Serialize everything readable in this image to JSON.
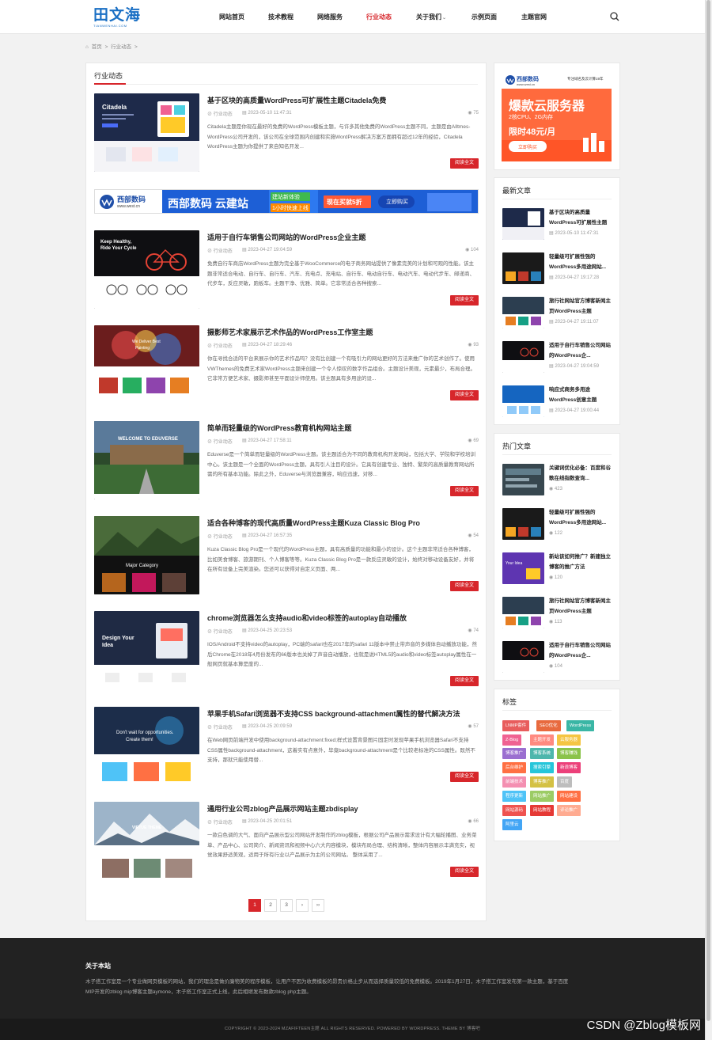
{
  "header": {
    "logo_main": "田文海",
    "logo_sub": "TIANWENHAI.COM",
    "nav": [
      {
        "label": "网站首页"
      },
      {
        "label": "技术教程"
      },
      {
        "label": "网络服务"
      },
      {
        "label": "行业动态"
      },
      {
        "label": "关于我们"
      },
      {
        "label": "示例页面"
      },
      {
        "label": "主题官网"
      }
    ],
    "search_icon": "search-icon"
  },
  "breadcrumb": {
    "home": "首页",
    "sep": ">",
    "current": "行业动态"
  },
  "main": {
    "section_title": "行业动态",
    "read_more_label": "阅读全文",
    "articles": [
      {
        "title": "基于区块的高质量WordPress可扩展性主题Citadela免费",
        "category": "行业动态",
        "date": "2023-05-10 11:47:31",
        "views": "75",
        "excerpt": "Citadela主题是你现在最好的免费的WordPress模板主题，与许多其他免费的WordPress主题不同，主题是由Alltmes-WordPress公司开发的，该公司在全球范围内创建和实施WordPress解决方案方面拥有超过12年的经验，Citadela WordPress主题为你提供了来自知名开发..."
      },
      {
        "title": "适用于自行车销售公司网站的WordPress企业主题",
        "category": "行业动态",
        "date": "2023-04-27 19:04:59",
        "views": "104",
        "excerpt": "免费自行车商店WordPress主题为完全基于WooCommerce的电子商务网站提供了像素完美的计划和可观的性能。该主题非常适合电动、自行车、自行车、汽车、充电点、充电站、自行车、电动自行车、电动汽车、电动代步车、邮递商、代步车，反应灵敏，跑板车。主题干净、优雅、简单。它非常适合各种搜索..."
      },
      {
        "title": "摄影师艺术家展示艺术作品的WordPress工作室主题",
        "category": "行业动态",
        "date": "2023-04-27 18:29:46",
        "views": "93",
        "excerpt": "你在寻找合适的平台来展示你的艺术作品吗？没有比创建一个有吸引力的网站更好的方法来推广你的艺术创作了。使用VWThemes的免费艺术家WordPress主题来创建一个令人惊叹的数字作品组合。主题设计美观，元素最少，布局合理。它非常方便艺术家、摄影师甚至平面设计师使用。该主题具有多用途的设..."
      },
      {
        "title": "简单而轻量级的WordPress教育机构网站主题",
        "category": "行业动态",
        "date": "2023-04-27 17:58:11",
        "views": "69",
        "excerpt": "Eduverse是一个简单而轻量级的WordPress主题。该主题适合为不同的教育机构开发网站，包括大学、学院和学校培训中心。该主题是一个全面的WordPress主题，具有引人注目的设计。它具有创建专业、独特、繁荣的高质量教育网站所需的所有基本功能。除此之外，Eduverse与浏览器兼容，响应迅速，对移..."
      },
      {
        "title": "适合各种博客的现代高质量WordPress主题Kuza Classic Blog Pro",
        "category": "行业动态",
        "date": "2023-04-27 16:57:35",
        "views": "54",
        "excerpt": "Kuza Classic Blog Pro是一个现代的WordPress主题，具有高质量的功能和最小的设计。这个主题非常适合各种博客，比如美食博客、旅游期刊、个人博客等等。Kuza Classic Blog Pro是一款反应灵敏的设计，始终对移动设备友好，并将在所有设备上完美渲染。您还可以获得对自定义页面、两..."
      },
      {
        "title": "chrome浏览器怎么支持audio和video标签的autoplay自动播放",
        "category": "行业动态",
        "date": "2023-04-25 20:23:53",
        "views": "74",
        "excerpt": "IOS/Android不支持video的autoplay，PC端的safari也在2017年的safari 11版本中禁止带声音的多媒体自动播放功能，然后Chrome在2018年4月份发布的66版本也关掉了声音自动播放，也就是说HTML5的audio和video标签autoplay属性在一般网页就基本算是废的..."
      },
      {
        "title": "苹果手机Safari浏览器不支持CSS background-attachment属性的替代解决方法",
        "category": "行业动态",
        "date": "2023-04-25 20:09:59",
        "views": "57",
        "excerpt": "在Web网页前端开发中使用background-attachment:fixed;样式设置背景图片固定时发现苹果手机浏览器Safari不支持CSS属性background-attachment，这着实有点意外，毕竟background-attachment是个比较老标准的CSS属性。既然不支持，那就只能使用替..."
      },
      {
        "title": "通用行业公司zblog产品展示网站主题zbdisplay",
        "category": "行业动态",
        "date": "2023-04-25 20:01:51",
        "views": "66",
        "excerpt": "一款白色调的大气、面向产品展示型公司网站开发制作的zblog模板，根据公司产品展示需求设计有大幅轮播图、业务菜单、产品中心、公司简介、新闻资讯和视频中心六大内容模块，模块布局合理、结构清晰，整体内容展示丰满充实，视觉效果舒适美观，适用于所有行业以产品展示为主的公司网站。 整体采用了..."
      }
    ],
    "banner_ad": {
      "brand": "西部数码",
      "brand_url": "www.west.cn",
      "headline": "西部数码 云建站",
      "badge1": "建站新体验",
      "badge2": "1小时快速上线",
      "promo": "现在买就5折",
      "cta": "立即购买"
    },
    "pagination": [
      "1",
      "2",
      "3",
      "›",
      "››"
    ]
  },
  "sidebar": {
    "ad": {
      "brand": "西部数码",
      "brand_url": "www.west.cn",
      "slogan": "专注域名及云计算19年",
      "headline": "爆款云服务器",
      "spec": "2核CPU、2G内存",
      "price": "限时48元/月",
      "cta": "立即购买"
    },
    "latest_title": "最新文章",
    "latest": [
      {
        "title": "基于区块的高质量WordPress可扩展性主题C...",
        "date": "2023-05-10 11:47:31"
      },
      {
        "title": "轻量级可扩展性强的WordPress多用途网站...",
        "date": "2023-04-27 19:17:28"
      },
      {
        "title": "旅行社网站官方博客新闻主页WordPress主题",
        "date": "2023-04-27 19:11:07"
      },
      {
        "title": "适用于自行车销售公司网站的WordPress企...",
        "date": "2023-04-27 19:04:59"
      },
      {
        "title": "响应式商务多用途WordPress创意主题EarnP...",
        "date": "2023-04-27 19:00:44"
      }
    ],
    "hot_title": "热门文章",
    "hot": [
      {
        "title": "关键词优化必备：百度和谷歌在线指数查询...",
        "views": "423"
      },
      {
        "title": "轻量级可扩展性强的WordPress多用途网站...",
        "views": "122"
      },
      {
        "title": "新站该如何推广？新建独立博客的推广方法",
        "views": "120"
      },
      {
        "title": "旅行社网站官方博客新闻主页WordPress主题",
        "views": "113"
      },
      {
        "title": "适用于自行车销售公司网站的WordPress企...",
        "views": "104"
      }
    ],
    "tags_title": "标签",
    "tags": [
      {
        "label": "LNMP套件",
        "color": "#e85d5d"
      },
      {
        "label": "SEO优化",
        "color": "#e86a3e"
      },
      {
        "label": "WordPress",
        "color": "#3ab6a5"
      },
      {
        "label": "Z-Blog",
        "color": "#f06292"
      },
      {
        "label": "主题开发",
        "color": "#ff8a80"
      },
      {
        "label": "云服务器",
        "color": "#f5c542"
      },
      {
        "label": "博客推广",
        "color": "#9b6fd0"
      },
      {
        "label": "博客系统",
        "color": "#4db6ac"
      },
      {
        "label": "博客赚钱",
        "color": "#8bc34a"
      },
      {
        "label": "后台维护",
        "color": "#ff7043"
      },
      {
        "label": "搜索引擎",
        "color": "#26c6da"
      },
      {
        "label": "新浪博客",
        "color": "#ec407a"
      },
      {
        "label": "前端技术",
        "color": "#f48fb1"
      },
      {
        "label": "博客推广",
        "color": "#d4c144"
      },
      {
        "label": "百度",
        "color": "#bdbdbd"
      },
      {
        "label": "程序更新",
        "color": "#4fc3f7"
      },
      {
        "label": "网站推广",
        "color": "#9ccc65"
      },
      {
        "label": "网站建设",
        "color": "#ff7043"
      },
      {
        "label": "网站源码",
        "color": "#ef5350"
      },
      {
        "label": "网站教程",
        "color": "#e53935"
      },
      {
        "label": "评论推广",
        "color": "#ffab91"
      },
      {
        "label": "阿里云",
        "color": "#42a5f5"
      }
    ]
  },
  "footer": {
    "title": "关于本站",
    "text": "木子搭工作室是一个专业做网页模板的网站，我们的理念是做价廉物美的程序模板，让用户不因为收费模板的昂贵价格止步从而选择质量较低的免费模板。2019年1月27日，木子搭工作室发布第一款主题，基于百度MIP开发的zblog mip博客主题aymone，木子搭工作室正式上线，此后相继发布数款zblog php主题。",
    "copyright": "COPYRIGHT © 2023-2024 MZAFIFTEEN主题 ALL RIGHTS RESERVED. POWERED BY WORDPRESS. THEME BY 博客吧",
    "watermark": "CSDN @Zblog模板网"
  },
  "colors": {
    "accent": "#d7262b",
    "brand": "#1a6fc4"
  }
}
